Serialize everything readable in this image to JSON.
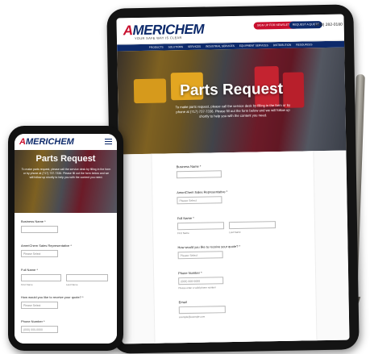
{
  "site": {
    "logo": "AMERICHEM",
    "logo_tagline": "YOUR SAFE WAY IS CLEAR",
    "newsletter_button": "SIGN UP FOR NEWSLETTER",
    "quote_button": "REQUEST A QUOTE",
    "phone": "(800) 282-0180",
    "nav": [
      "PRODUCTS",
      "SOLUTIONS",
      "SERVICES",
      "INDUSTRIAL SERVICES",
      "EQUIPMENT SERVICES",
      "DISTRIBUTION",
      "RESOURCES"
    ]
  },
  "hero": {
    "title": "Parts Request",
    "description": "To make parts request, please call the service desk by filling in the form or by phone at (717) 737-7336. Please fill out the form below and we will follow up shortly to help you with the content you need."
  },
  "form": {
    "business_name_label": "Business Name *",
    "rep_label": "AmeriChem Sales Representative *",
    "rep_value": "Please Select",
    "full_name_label": "Full Name *",
    "first_name_sub": "First Name",
    "last_name_sub": "Last Name",
    "contact_label": "How would you like to receive your quote? *",
    "contact_value": "Please Select",
    "phone_label": "Phone Number *",
    "phone_placeholder": "(000) 000-0000",
    "phone_sub": "Please enter a valid phone number",
    "email_label": "Email",
    "email_sub": "example@example.com"
  },
  "colors": {
    "brand_navy": "#0d2a6b",
    "brand_red": "#c8102e"
  }
}
